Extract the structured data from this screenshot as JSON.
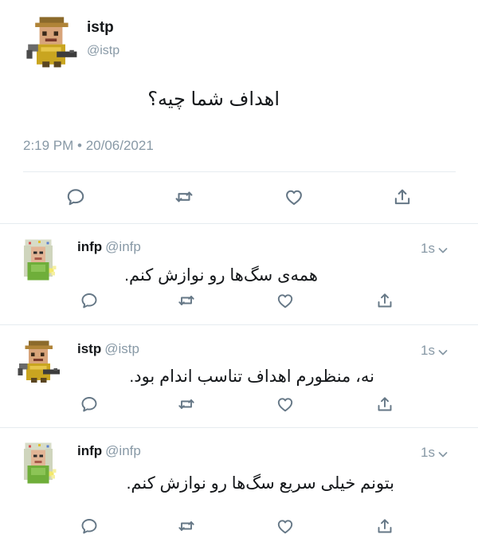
{
  "main_tweet": {
    "name": "istp",
    "handle": "@istp",
    "text": "اهداف شما چیه؟",
    "timestamp": "2:19 PM • 20/06/2021",
    "avatar_icon": "istp-pixel-avatar-icon"
  },
  "replies": [
    {
      "name": "infp",
      "handle": "@infp",
      "time": "1s",
      "text": "همه‌ی سگ‌ها رو نوازش کنم.",
      "avatar_icon": "infp-pixel-avatar-icon"
    },
    {
      "name": "istp",
      "handle": "@istp",
      "time": "1s",
      "text": "نه، منظورم اهداف تناسب اندام بود.",
      "avatar_icon": "istp-pixel-avatar-icon"
    },
    {
      "name": "infp",
      "handle": "@infp",
      "time": "1s",
      "text": "بتونم خیلی سریع سگ‌ها رو نوازش کنم.",
      "avatar_icon": "infp-pixel-avatar-icon"
    }
  ],
  "actions": [
    "reply-icon",
    "retweet-icon",
    "like-icon",
    "share-icon"
  ],
  "colors": {
    "muted": "#8899a6",
    "text": "#14171a",
    "divider": "#e6ecf0"
  }
}
